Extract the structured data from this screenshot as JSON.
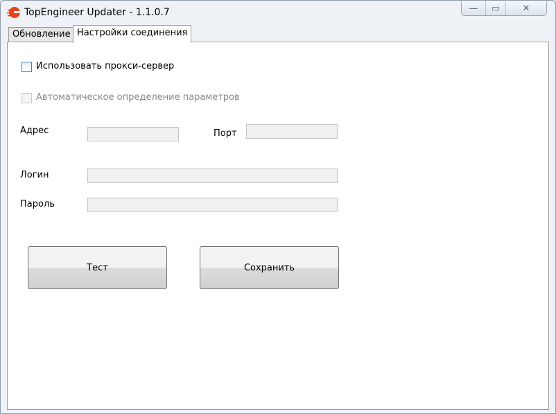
{
  "window": {
    "title": "TopEngineer Updater - 1.1.0.7",
    "minimize": "—",
    "maximize": "▭",
    "close": "✕"
  },
  "tabs": [
    {
      "label": "Обновление"
    },
    {
      "label": "Настройки соединения"
    }
  ],
  "form": {
    "use_proxy": "Использовать прокси-сервер",
    "auto_detect": "Автоматическое определение параметров",
    "address": "Адрес",
    "port": "Порт",
    "login": "Логин",
    "password": "Пароль",
    "address_value": "",
    "port_value": "",
    "login_value": "",
    "password_value": ""
  },
  "buttons": {
    "test": "Тест",
    "save": "Сохранить"
  }
}
